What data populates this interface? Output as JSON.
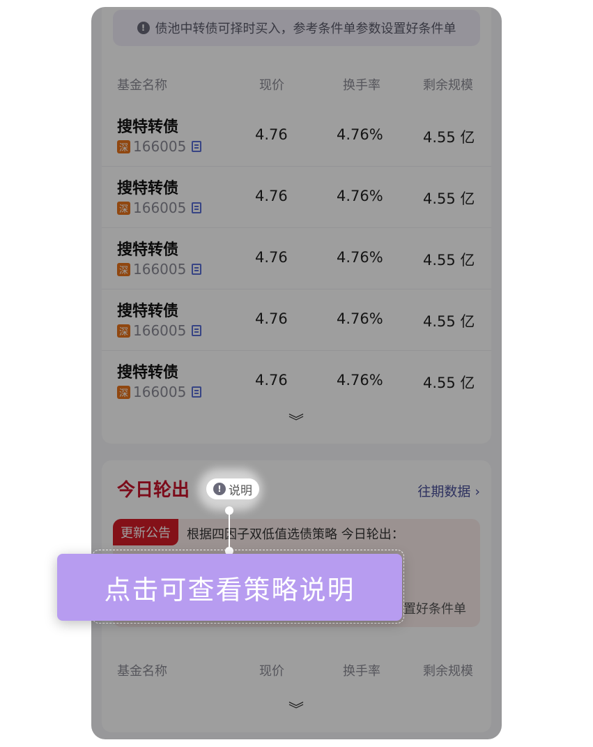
{
  "notice": {
    "text": "债池中转债可择时买入，参考条件单参数设置好条件单"
  },
  "table_headers": {
    "name": "基金名称",
    "price": "现价",
    "turnover": "换手率",
    "scale": "剩余规模"
  },
  "rows": [
    {
      "name": "搜特转债",
      "exchange": "深",
      "code": "166005",
      "price": "4.76",
      "turnover": "4.76%",
      "scale": "4.55 亿"
    },
    {
      "name": "搜特转债",
      "exchange": "深",
      "code": "166005",
      "price": "4.76",
      "turnover": "4.76%",
      "scale": "4.55 亿"
    },
    {
      "name": "搜特转债",
      "exchange": "深",
      "code": "166005",
      "price": "4.76",
      "turnover": "4.76%",
      "scale": "4.55 亿"
    },
    {
      "name": "搜特转债",
      "exchange": "深",
      "code": "166005",
      "price": "4.76",
      "turnover": "4.76%",
      "scale": "4.55 亿"
    },
    {
      "name": "搜特转债",
      "exchange": "深",
      "code": "166005",
      "price": "4.76",
      "turnover": "4.76%",
      "scale": "4.55 亿"
    }
  ],
  "today_section": {
    "title": "今日轮出",
    "explain_label": "说明",
    "history_label": "往期数据",
    "announce_tag": "更新公告",
    "announce_text": "根据四因子双低值选债策略 今日轮出：",
    "announce_sub": "置好条件单"
  },
  "callout": {
    "text": "点击可查看策略说明"
  },
  "icons": {
    "info": "info-circle-icon",
    "copy": "copy-icon",
    "expand": "double-chevron-down-icon",
    "chevron_right": "chevron-right-icon"
  },
  "colors": {
    "accent_red": "#c8132b",
    "callout_purple": "#b79cf0",
    "exchange_orange": "#e8731a",
    "link_blue": "#4a4f9a"
  }
}
